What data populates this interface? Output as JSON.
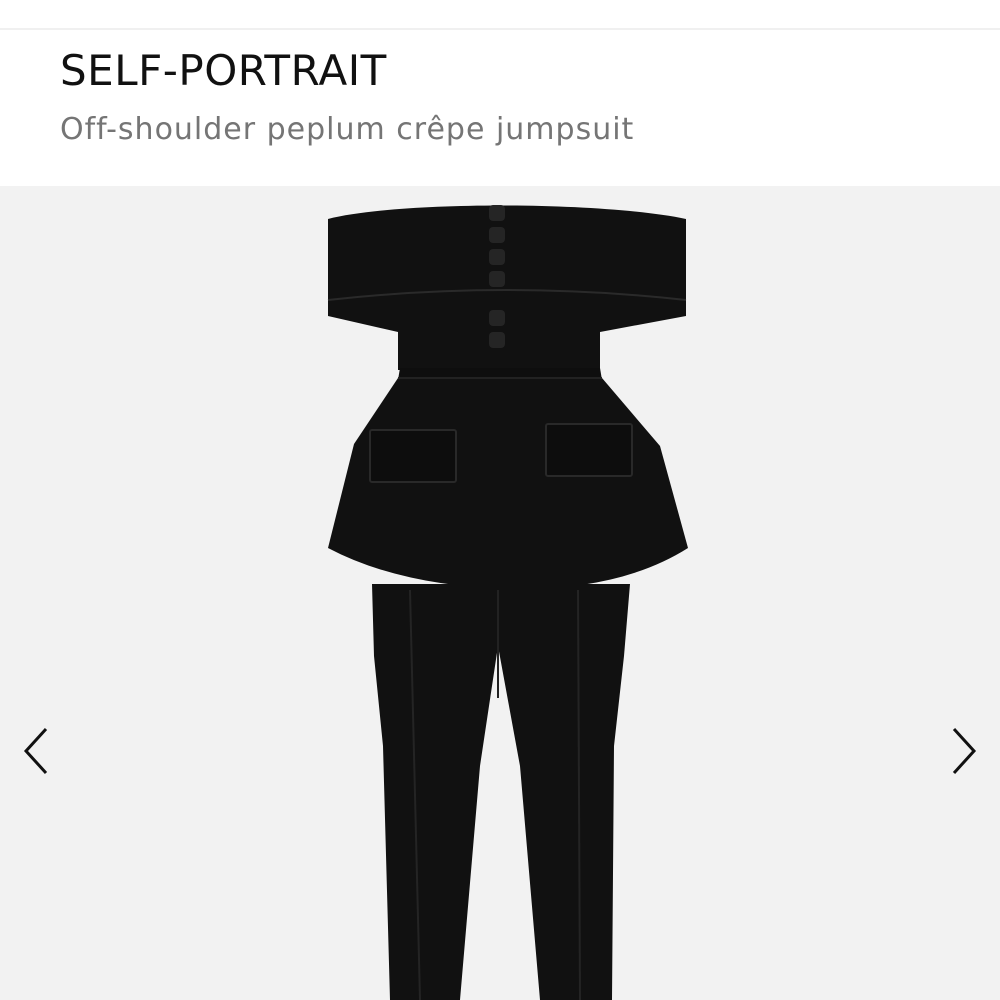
{
  "product": {
    "brand": "SELF-PORTRAIT",
    "name": "Off-shoulder peplum crêpe jumpsuit"
  },
  "gallery": {
    "image_description_icon": "black-jumpsuit-photo",
    "prev_icon": "chevron-left-icon",
    "next_icon": "chevron-right-icon"
  },
  "colors": {
    "garment": "#111111",
    "background": "#f2f2f2",
    "text_primary": "#111111",
    "text_secondary": "#757575"
  }
}
